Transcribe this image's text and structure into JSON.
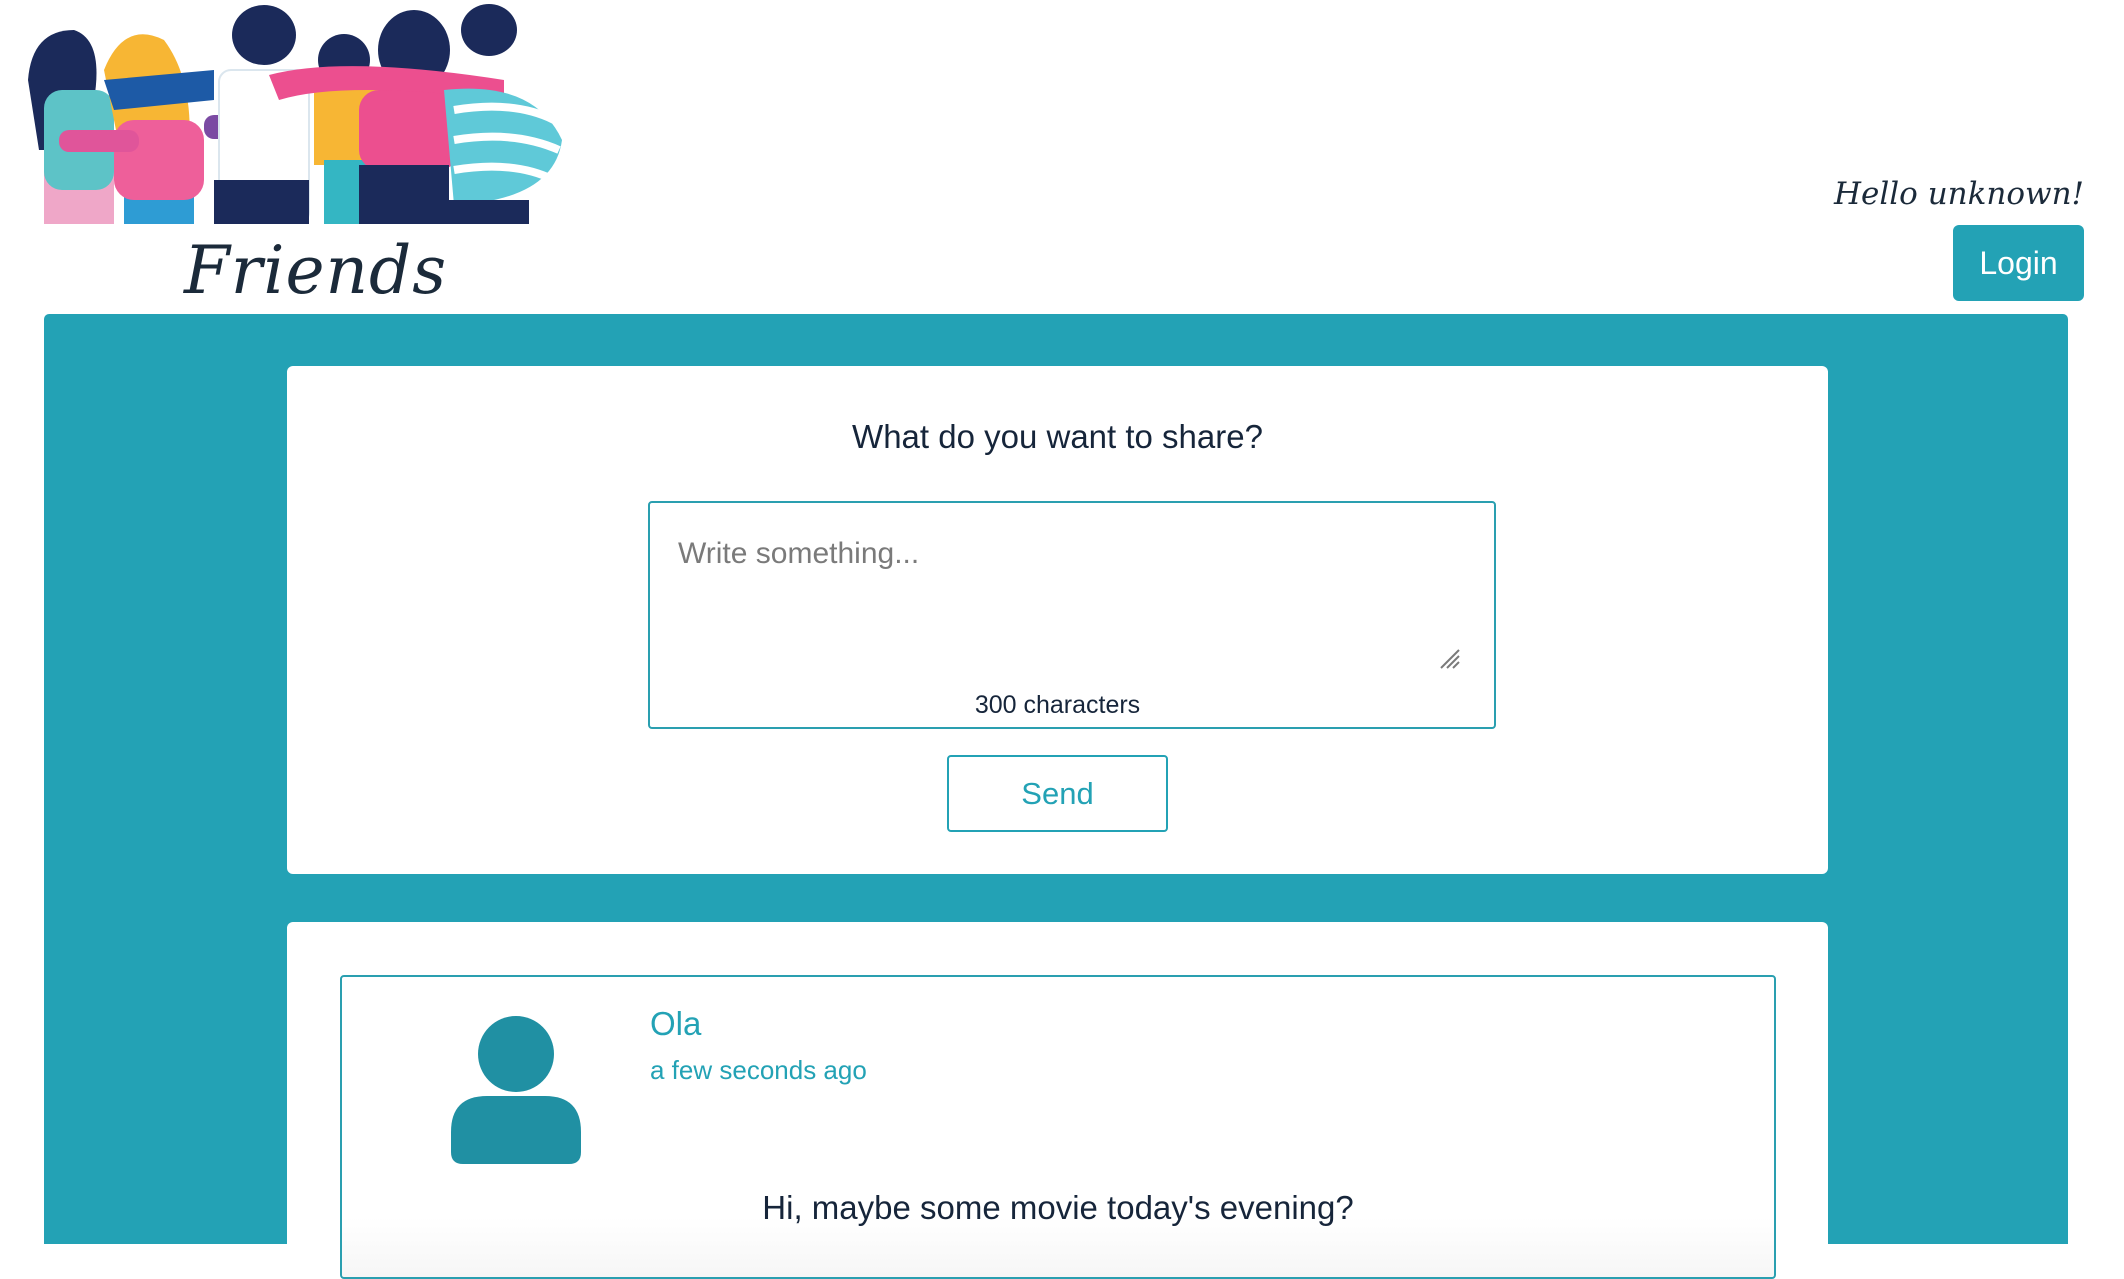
{
  "header": {
    "brand": "Friends",
    "greeting": "Hello unknown!",
    "login_label": "Login"
  },
  "composer": {
    "title": "What do you want to share?",
    "placeholder": "Write something...",
    "char_count": "300 characters",
    "send_label": "Send"
  },
  "feed": {
    "posts": [
      {
        "author": "Ola",
        "time": "a few seconds ago",
        "text": "Hi, maybe some movie today's evening?"
      }
    ]
  },
  "colors": {
    "accent": "#23a2b5",
    "text": "#1b2a3a"
  },
  "icons": {
    "avatar": "user-avatar-icon",
    "hero": "friends-hug-illustration"
  }
}
